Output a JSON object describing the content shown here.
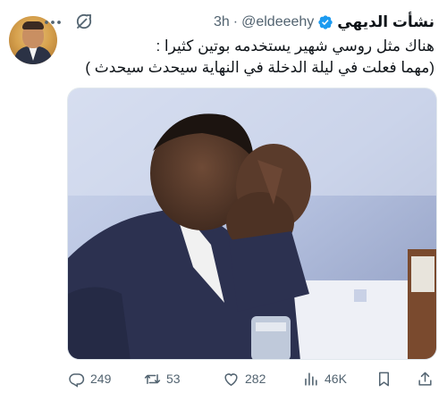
{
  "author": {
    "display_name": "نشأت الديهي",
    "handle": "@eldeeehy",
    "separator": "·",
    "time": "3h"
  },
  "tweet": {
    "lines": [
      "هناك مثل روسي شهير يستخدمه بوتين كثيرا :",
      "(مهما فعلت في ليلة الدخلة في النهاية سيحدث سيحدث )"
    ]
  },
  "actions": {
    "replies": "249",
    "retweets": "53",
    "likes": "282",
    "views": "46K"
  },
  "colors": {
    "text": "#0f1419",
    "secondary": "#536471",
    "verified": "#1d9bf0"
  },
  "icons": [
    "more-icon",
    "grok-icon",
    "verified-icon",
    "reply-icon",
    "retweet-icon",
    "like-icon",
    "views-icon",
    "bookmark-icon",
    "share-icon"
  ]
}
